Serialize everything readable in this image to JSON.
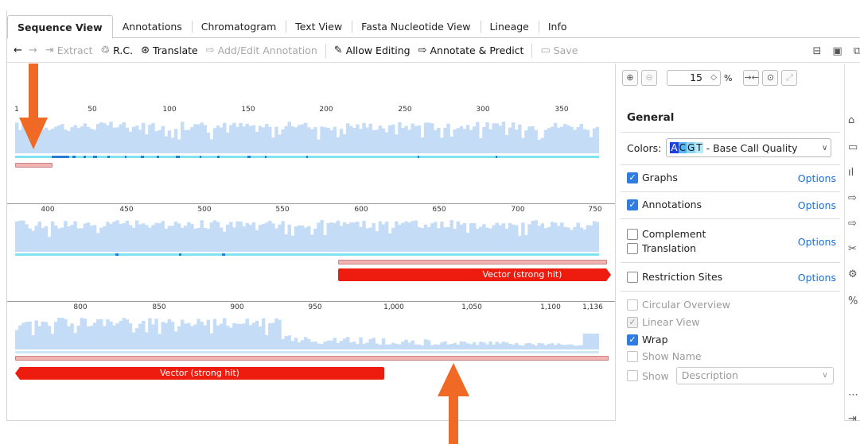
{
  "tabs": [
    {
      "label": "Sequence View",
      "active": true
    },
    {
      "label": "Annotations"
    },
    {
      "label": "Chromatogram"
    },
    {
      "label": "Text View"
    },
    {
      "label": "Fasta Nucleotide View"
    },
    {
      "label": "Lineage"
    },
    {
      "label": "Info"
    }
  ],
  "toolbar": {
    "back_icon": "←",
    "forward_icon": "→",
    "extract": "Extract",
    "rc": "R.C.",
    "translate": "Translate",
    "add_edit": "Add/Edit Annotation",
    "allow_editing": "Allow Editing",
    "annotate_predict": "Annotate & Predict",
    "save": "Save"
  },
  "rows": [
    {
      "ticks": [
        "1",
        "50",
        "100",
        "150",
        "200",
        "250",
        "300",
        "350"
      ]
    },
    {
      "ticks": [
        "400",
        "450",
        "500",
        "550",
        "600",
        "650",
        "700",
        "750"
      ]
    },
    {
      "ticks": [
        "800",
        "850",
        "900",
        "950",
        "1,000",
        "1,050",
        "1,100",
        "1,136"
      ]
    }
  ],
  "annotations": [
    {
      "label": "Vector (strong hit)"
    },
    {
      "label": "Vector (strong hit)"
    }
  ],
  "panel": {
    "zoom_value": "15",
    "zoom_unit": "%",
    "title": "General",
    "colors_label": "Colors:",
    "acgt": [
      "A",
      "C",
      "G",
      "T"
    ],
    "acgt_colors": [
      "#1e40e0",
      "#57b6f0",
      "#8fd6f5",
      "#b9ecf9"
    ],
    "color_scheme": "- Base Call Quality",
    "options_label": "Options",
    "graphs": "Graphs",
    "annotations": "Annotations",
    "complement": "Complement",
    "translation": "Translation",
    "restriction_sites": "Restriction Sites",
    "circular_overview": "Circular Overview",
    "linear_view": "Linear View",
    "wrap": "Wrap",
    "show_name": "Show Name",
    "show": "Show",
    "description": "Description"
  }
}
